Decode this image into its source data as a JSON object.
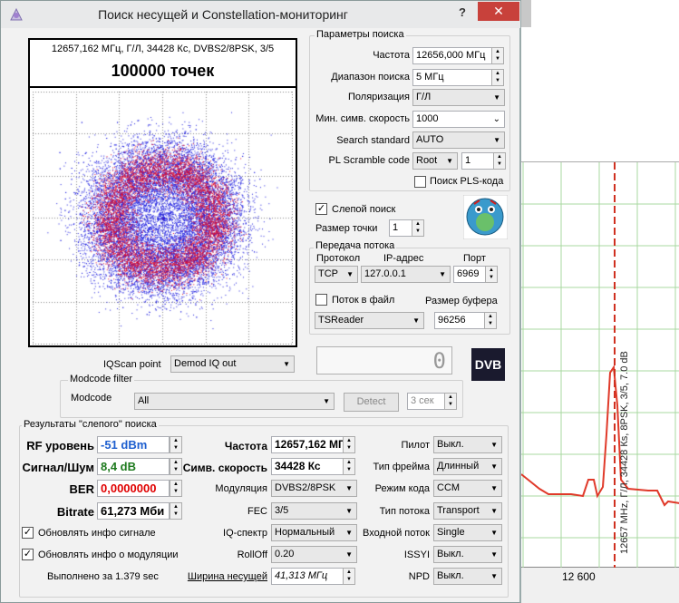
{
  "window": {
    "title": "Поиск несущей и Constellation-мониторинг",
    "help": "?",
    "close": "✕"
  },
  "constellation": {
    "info": "12657,162 МГц, Г/Л, 34428 Кс, DVBS2/8PSK, 3/5",
    "points": "100000 точек"
  },
  "search_params": {
    "title": "Параметры поиска",
    "freq_label": "Частота",
    "freq_value": "12656,000 МГц",
    "range_label": "Диапазон поиска",
    "range_value": "5 МГц",
    "pol_label": "Поляризация",
    "pol_value": "Г/Л",
    "minsym_label": "Мин. симв. скорость",
    "minsym_value": "1000",
    "std_label": "Search standard",
    "std_value": "AUTO",
    "pls_label": "PL Scramble code",
    "pls_mode": "Root",
    "pls_value": "1",
    "pls_search_label": "Поиск PLS-кода"
  },
  "blind": {
    "blind_label": "Слепой поиск",
    "blind_checked": true,
    "dotsize_label": "Размер точки",
    "dotsize_value": "1"
  },
  "stream": {
    "title": "Передача потока",
    "proto_label": "Протокол",
    "ip_label": "IP-адрес",
    "port_label": "Порт",
    "proto_value": "TCP",
    "ip_value": "127.0.0.1",
    "port_value": "6969",
    "tofile_label": "Поток в файл",
    "tofile_checked": false,
    "bufsize_label": "Размер буфера",
    "target_value": "TSReader",
    "bufsize_value": "96256"
  },
  "iq": {
    "point_label": "IQScan point",
    "point_value": "Demod IQ out",
    "counter": "0",
    "logo": "DVB"
  },
  "modcode": {
    "title": "Modcode filter",
    "label": "Modcode",
    "value": "All",
    "detect": "Detect",
    "timeout": "3 сек"
  },
  "results": {
    "title": "Результаты \"слепого\" поиска",
    "rf_label": "RF уровень",
    "rf_value": "-51 dBm",
    "snr_label": "Сигнал/Шум",
    "snr_value": "8,4 dB",
    "ber_label": "BER",
    "ber_value": "0,0000000",
    "bitrate_label": "Bitrate",
    "bitrate_value": "61,273 Мби",
    "freq_label": "Частота",
    "freq_value": "12657,162 МГ",
    "sym_label": "Симв. скорость",
    "sym_value": "34428 Кс",
    "mod_label": "Модуляция",
    "mod_value": "DVBS2/8PSK",
    "fec_label": "FEC",
    "fec_value": "3/5",
    "iqspec_label": "IQ-спектр",
    "iqspec_value": "Нормальный",
    "rolloff_label": "RollOff",
    "rolloff_value": "0.20",
    "bw_label": "Ширина несущей",
    "bw_value": "41,313 МГц",
    "pilot_label": "Пилот",
    "pilot_value": "Выкл.",
    "frame_label": "Тип фрейма",
    "frame_value": "Длинный",
    "codemode_label": "Режим кода",
    "codemode_value": "CCM",
    "streamtype_label": "Тип потока",
    "streamtype_value": "Transport",
    "input_label": "Входной поток",
    "input_value": "Single",
    "issyi_label": "ISSYI",
    "issyi_value": "Выкл.",
    "npd_label": "NPD",
    "npd_value": "Выкл.",
    "upd_signal_label": "Обновлять инфо сигнале",
    "upd_signal_checked": true,
    "upd_mod_label": "Обновлять инфо о модуляции",
    "upd_mod_checked": true,
    "done": "Выполнено за 1.379 sec"
  },
  "spectrum": {
    "marker_label": "12657 MHz, Г/Л, 34428 Кs, 8PSK, 3/5, 7.0 dB",
    "tick": "12 600"
  },
  "colors": {
    "rf": "#1e5fcf",
    "snr": "#1e7a1e",
    "ber": "#e00000",
    "close": "#c8413b",
    "trace": "#e03a2a",
    "grid": "#a8d8a0",
    "const_outer": "#2020e0",
    "const_inner": "#e01030"
  }
}
